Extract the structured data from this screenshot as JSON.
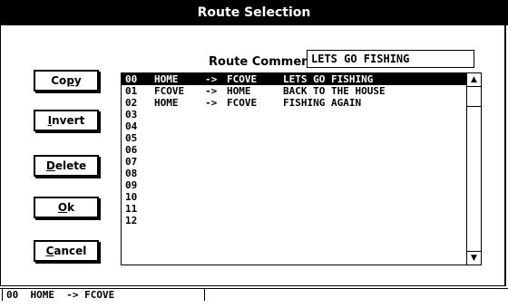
{
  "window": {
    "title": "Route Selection"
  },
  "route_comment": {
    "label": "Route Comment:",
    "value": "LETS GO FISHING"
  },
  "buttons": {
    "copy": {
      "pre": "Co",
      "ul": "p",
      "post": "y"
    },
    "invert": {
      "pre": "",
      "ul": "I",
      "post": "nvert"
    },
    "delete": {
      "pre": "",
      "ul": "D",
      "post": "elete"
    },
    "ok": {
      "pre": "",
      "ul": "O",
      "post": "k"
    },
    "cancel": {
      "pre": "",
      "ul": "C",
      "post": "ancel"
    }
  },
  "routes": [
    {
      "num": "00",
      "from": "HOME",
      "arrow": "->",
      "to": "FCOVE",
      "comment": "LETS GO FISHING",
      "selected": true
    },
    {
      "num": "01",
      "from": "FCOVE",
      "arrow": "->",
      "to": "HOME",
      "comment": "BACK TO THE HOUSE"
    },
    {
      "num": "02",
      "from": "HOME",
      "arrow": "->",
      "to": "FCOVE",
      "comment": "FISHING AGAIN"
    },
    {
      "num": "03"
    },
    {
      "num": "04"
    },
    {
      "num": "05"
    },
    {
      "num": "06"
    },
    {
      "num": "07"
    },
    {
      "num": "08"
    },
    {
      "num": "09"
    },
    {
      "num": "10"
    },
    {
      "num": "11"
    },
    {
      "num": "12"
    }
  ],
  "scrollbar": {
    "up_icon": "▲",
    "down_icon": "▼"
  },
  "status": {
    "text": "00  HOME  -> FCOVE"
  }
}
